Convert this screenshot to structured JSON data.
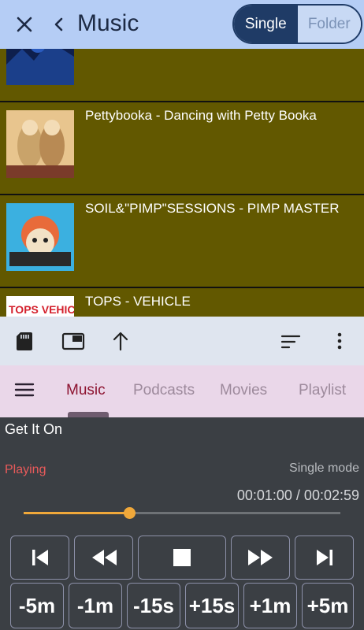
{
  "header": {
    "title": "Music",
    "close_icon": "close-icon",
    "back_icon": "chevron-left-icon",
    "segments": [
      "Single",
      "Folder"
    ],
    "selected_segment": "Single"
  },
  "tracks": [
    {
      "name": "",
      "art_colors": [
        "#1b3f8a",
        "#0e1f4d"
      ]
    },
    {
      "name": "Pettybooka - Dancing with Petty Booka",
      "art_colors": [
        "#c9a36a",
        "#e8c58e"
      ]
    },
    {
      "name": "SOIL&\"PIMP\"SESSIONS - PIMP MASTER",
      "art_colors": [
        "#e86b3a",
        "#3bb0e0"
      ]
    },
    {
      "name": "TOPS - VEHICLE",
      "art_text": "TOPS VEHICLE",
      "art_colors": [
        "#ffffff",
        "#d4202c"
      ]
    }
  ],
  "toolbar": {
    "icons": [
      "sd-card-icon",
      "picture-in-picture-icon",
      "arrow-up-icon",
      "sort-icon",
      "more-vert-icon"
    ]
  },
  "tabs": {
    "menu_icon": "hamburger-menu-icon",
    "items": [
      "Music",
      "Podcasts",
      "Movies",
      "Playlist"
    ],
    "active": "Music"
  },
  "player": {
    "now_playing": "Get It On",
    "status": "Playing",
    "mode": "Single mode",
    "time": "00:01:00 / 00:02:59",
    "progress_fraction": 0.335,
    "controls": [
      "skip-previous-icon",
      "rewind-icon",
      "stop-icon",
      "fast-forward-icon",
      "skip-next-icon"
    ],
    "jumps": [
      "-5m",
      "-1m",
      "-15s",
      "+15s",
      "+1m",
      "+5m"
    ]
  },
  "colors": {
    "header_bg": "#b5cdf5",
    "accent_blue": "#1f3b66",
    "row_bg": "#625800",
    "toolbar_bg": "#dfe5ef",
    "tabs_bg": "#ead7e9",
    "active_tab": "#8d1330",
    "player_bg": "#3b3f44",
    "status_red": "#e85a5a",
    "seek_orange": "#f0a83a"
  }
}
